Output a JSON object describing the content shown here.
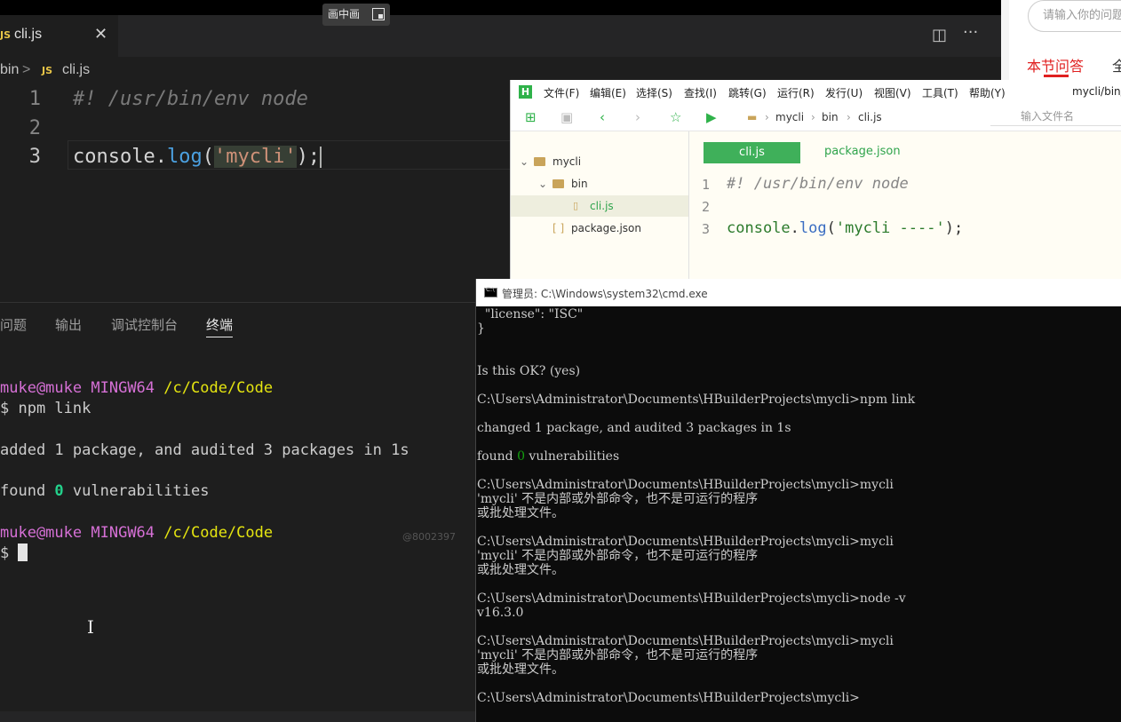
{
  "vscode": {
    "pip_label": "画中画",
    "tab": {
      "icon_text": "JS",
      "filename": "cli.js",
      "close": "✕"
    },
    "toolbar": {
      "split": "◫",
      "more": "···"
    },
    "breadcrumb": {
      "folder": "bin",
      "sep": ">",
      "icon_text": "JS",
      "file": "cli.js"
    },
    "lines": [
      {
        "num": "1",
        "comment": "#! /usr/bin/env node"
      },
      {
        "num": "2"
      },
      {
        "num": "3",
        "obj": "console",
        "dot": ".",
        "fn": "log",
        "open": "(",
        "str": "'mycli'",
        "close": ");"
      }
    ],
    "panel_tabs": [
      "问题",
      "输出",
      "调试控制台",
      "终端"
    ],
    "terminal": {
      "prompt_user": "muke@muke",
      "prompt_host": "MINGW64",
      "prompt_path": "/c/Code/Code",
      "cmd1": "$ npm link",
      "out1": "added 1 package, and audited 3 packages in 1s",
      "out2_pre": "found ",
      "out2_num": "0",
      "out2_post": " vulnerabilities",
      "prompt2": "$ ",
      "watermark": "@8002397"
    }
  },
  "web": {
    "search_placeholder": "请输入你的问题",
    "tab_active": "本节问答",
    "tab_other": "全"
  },
  "hbuilder": {
    "logo": "H",
    "menu": [
      "文件(F)",
      "编辑(E)",
      "选择(S)",
      "查找(I)",
      "跳转(G)",
      "运行(R)",
      "发行(U)",
      "视图(V)",
      "工具(T)",
      "帮助(Y)"
    ],
    "window_path": "mycli/bin/",
    "path": [
      "mycli",
      "bin",
      "cli.js"
    ],
    "file_search_placeholder": "输入文件名",
    "tree": [
      {
        "label": "mycli"
      },
      {
        "label": "bin"
      },
      {
        "label": "cli.js"
      },
      {
        "label": "package.json",
        "prefix": "[ ]"
      }
    ],
    "tabs": {
      "active": "cli.js",
      "other": "package.json"
    },
    "lines": [
      {
        "num": "1",
        "comment": "#! /usr/bin/env node"
      },
      {
        "num": "2"
      },
      {
        "num": "3",
        "obj": "console",
        "dot": ".",
        "fn": "log",
        "open": "(",
        "str": "'mycli ----'",
        "close": ");"
      }
    ]
  },
  "cmd": {
    "title": "管理员: C:\\Windows\\system32\\cmd.exe",
    "lines": [
      "  \"license\": \"ISC\"",
      "}",
      "",
      "",
      "Is this OK? (yes)",
      "",
      "C:\\Users\\Administrator\\Documents\\HBuilderProjects\\mycli>npm link",
      "",
      "changed 1 package, and audited 3 packages in 1s",
      "",
      "found 0 vulnerabilities",
      "",
      "C:\\Users\\Administrator\\Documents\\HBuilderProjects\\mycli>mycli",
      "'mycli' 不是内部或外部命令，也不是可运行的程序",
      "或批处理文件。",
      "",
      "C:\\Users\\Administrator\\Documents\\HBuilderProjects\\mycli>mycli",
      "'mycli' 不是内部或外部命令，也不是可运行的程序",
      "或批处理文件。",
      "",
      "C:\\Users\\Administrator\\Documents\\HBuilderProjects\\mycli>node -v",
      "v16.3.0",
      "",
      "C:\\Users\\Administrator\\Documents\\HBuilderProjects\\mycli>mycli",
      "'mycli' 不是内部或外部命令，也不是可运行的程序",
      "或批处理文件。",
      "",
      "C:\\Users\\Administrator\\Documents\\HBuilderProjects\\mycli>"
    ]
  }
}
